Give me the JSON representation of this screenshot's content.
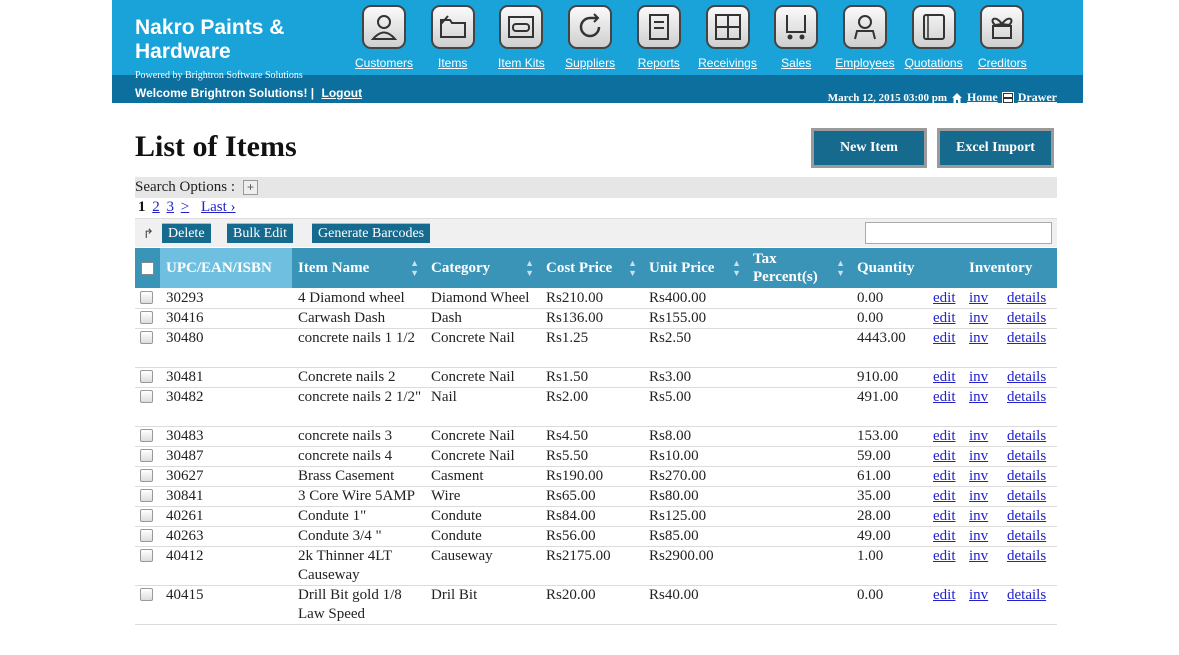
{
  "header": {
    "brand": "Nakro Paints & Hardware",
    "powered_by": "Powered by Brightron Software Solutions",
    "welcome": "Welcome Brightron Solutions!  |",
    "logout": "Logout",
    "datetime": "March 12, 2015 03:00 pm",
    "home": "Home",
    "drawer": "Drawer",
    "nav": [
      {
        "label": "Customers",
        "icon": "person-icon"
      },
      {
        "label": "Items",
        "icon": "folder-icon"
      },
      {
        "label": "Item Kits",
        "icon": "kit-box-icon"
      },
      {
        "label": "Suppliers",
        "icon": "refresh-arrow-icon"
      },
      {
        "label": "Reports",
        "icon": "report-doc-icon"
      },
      {
        "label": "Receivings",
        "icon": "grid-window-icon"
      },
      {
        "label": "Sales",
        "icon": "cart-icon"
      },
      {
        "label": "Employees",
        "icon": "employee-icon"
      },
      {
        "label": "Quotations",
        "icon": "notepad-icon"
      },
      {
        "label": "Creditors",
        "icon": "gift-bow-icon"
      }
    ]
  },
  "page": {
    "title": "List of Items",
    "new_item": "New Item",
    "excel_import": "Excel Import",
    "search_options": "Search Options :",
    "pager": {
      "current": "1",
      "pages": [
        "2",
        "3"
      ],
      "next": ">",
      "last": "Last ›"
    },
    "toolbar": {
      "delete": "Delete",
      "bulk_edit": "Bulk Edit",
      "generate_barcodes": "Generate Barcodes"
    }
  },
  "table": {
    "columns": [
      "UPC/EAN/ISBN",
      "Item Name",
      "Category",
      "Cost Price",
      "Unit Price",
      "Tax Percent(s)",
      "Quantity",
      "Inventory"
    ],
    "links": {
      "edit": "edit",
      "inv": "inv",
      "details": "details"
    },
    "rows": [
      {
        "upc": "30293",
        "name": "4 Diamond wheel",
        "category": "Diamond Wheel",
        "cost": "Rs210.00",
        "unit": "Rs400.00",
        "qty": "0.00"
      },
      {
        "upc": "30416",
        "name": "Carwash Dash",
        "category": "Dash",
        "cost": "Rs136.00",
        "unit": "Rs155.00",
        "qty": "0.00"
      },
      {
        "upc": "30480",
        "name": "concrete nails 1 1/2",
        "category": "Concrete Nail",
        "cost": "Rs1.25",
        "unit": "Rs2.50",
        "qty": "4443.00"
      },
      {
        "upc": "30481",
        "name": "Concrete nails 2",
        "category": "Concrete Nail",
        "cost": "Rs1.50",
        "unit": "Rs3.00",
        "qty": "910.00"
      },
      {
        "upc": "30482",
        "name": "concrete nails 2 1/2\"",
        "category": "Nail",
        "cost": "Rs2.00",
        "unit": "Rs5.00",
        "qty": "491.00"
      },
      {
        "upc": "30483",
        "name": "concrete nails 3",
        "category": "Concrete Nail",
        "cost": "Rs4.50",
        "unit": "Rs8.00",
        "qty": "153.00"
      },
      {
        "upc": "30487",
        "name": "concrete nails 4",
        "category": "Concrete Nail",
        "cost": "Rs5.50",
        "unit": "Rs10.00",
        "qty": "59.00"
      },
      {
        "upc": "30627",
        "name": "Brass Casement",
        "category": "Casment",
        "cost": "Rs190.00",
        "unit": "Rs270.00",
        "qty": "61.00"
      },
      {
        "upc": "30841",
        "name": "3 Core Wire 5AMP",
        "category": "Wire",
        "cost": "Rs65.00",
        "unit": "Rs80.00",
        "qty": "35.00"
      },
      {
        "upc": "40261",
        "name": "Condute 1\"",
        "category": "Condute",
        "cost": "Rs84.00",
        "unit": "Rs125.00",
        "qty": "28.00"
      },
      {
        "upc": "40263",
        "name": "Condute 3/4 \"",
        "category": "Condute",
        "cost": "Rs56.00",
        "unit": "Rs85.00",
        "qty": "49.00"
      },
      {
        "upc": "40412",
        "name": "2k Thinner 4LT Causeway",
        "category": "Causeway",
        "cost": "Rs2175.00",
        "unit": "Rs2900.00",
        "qty": "1.00"
      },
      {
        "upc": "40415",
        "name": "Drill Bit gold 1/8 Law Speed",
        "category": "Dril Bit",
        "cost": "Rs20.00",
        "unit": "Rs40.00",
        "qty": "0.00"
      }
    ]
  },
  "colors": {
    "header_bg": "#1aa3d8",
    "header_band": "#0d6f9e",
    "button_bg": "#156a8e",
    "table_header": "#3a94b8"
  }
}
